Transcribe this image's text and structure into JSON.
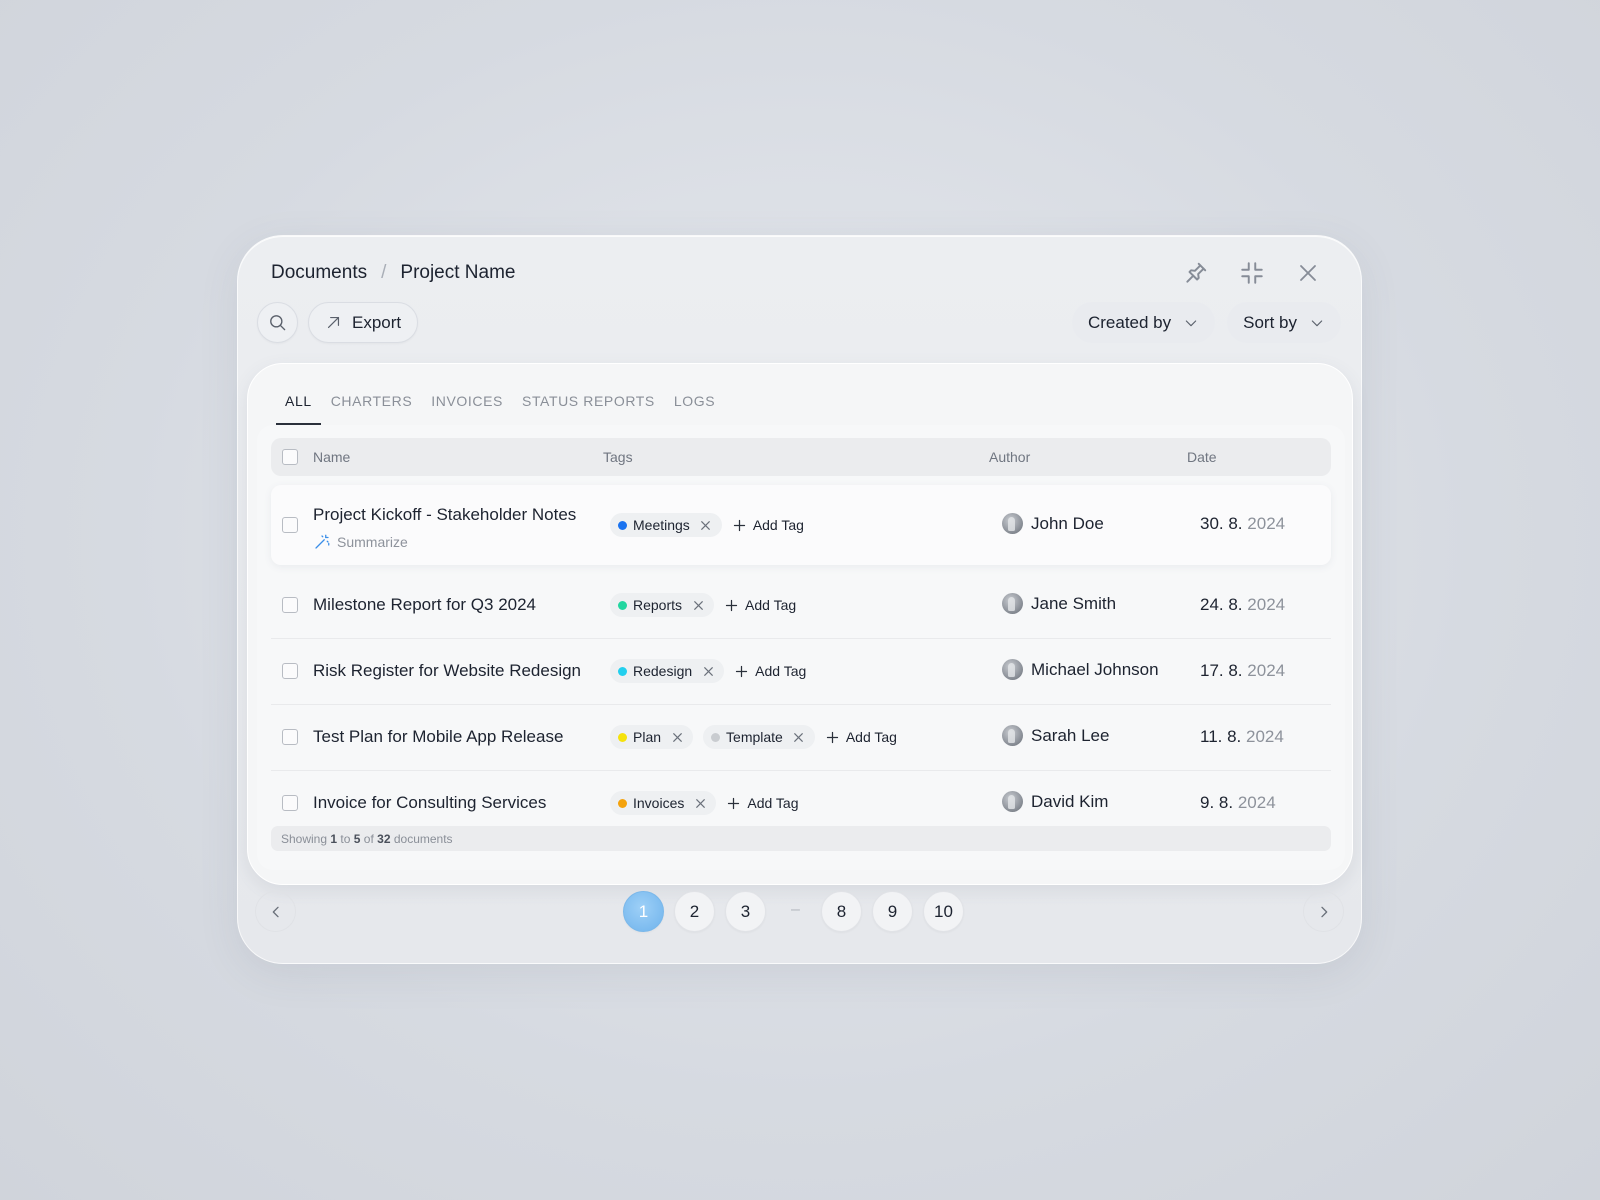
{
  "breadcrumb": {
    "root": "Documents",
    "separator": "/",
    "current": "Project Name"
  },
  "window_controls": {
    "pin": "pin-icon",
    "minimize": "collapse-icon",
    "close": "close-icon"
  },
  "toolbar": {
    "search_icon": "search-icon",
    "export_label": "Export",
    "created_by_label": "Created by",
    "sort_by_label": "Sort by"
  },
  "tabs": [
    {
      "label": "ALL",
      "active": true
    },
    {
      "label": "CHARTERS",
      "active": false
    },
    {
      "label": "INVOICES",
      "active": false
    },
    {
      "label": "STATUS REPORTS",
      "active": false
    },
    {
      "label": "LOGS",
      "active": false
    }
  ],
  "table": {
    "columns": {
      "name": "Name",
      "tags": "Tags",
      "author": "Author",
      "date": "Date"
    },
    "add_tag_label": "Add Tag",
    "summarize_label": "Summarize",
    "rows": [
      {
        "name": "Project Kickoff - Stakeholder Notes",
        "tags": [
          {
            "label": "Meetings",
            "color": "#1a73f0"
          }
        ],
        "author": "John Doe",
        "date_day": "30. 8.",
        "date_year": "2024"
      },
      {
        "name": "Milestone Report for Q3 2024",
        "tags": [
          {
            "label": "Reports",
            "color": "#22d6a0"
          }
        ],
        "author": "Jane Smith",
        "date_day": "24. 8.",
        "date_year": "2024"
      },
      {
        "name": "Risk Register for Website Redesign",
        "tags": [
          {
            "label": "Redesign",
            "color": "#22cfee"
          }
        ],
        "author": "Michael Johnson",
        "date_day": "17. 8.",
        "date_year": "2024"
      },
      {
        "name": "Test Plan for Mobile App Release",
        "tags": [
          {
            "label": "Plan",
            "color": "#f5e20c"
          },
          {
            "label": "Template",
            "color": "#c9ccd0"
          }
        ],
        "author": "Sarah Lee",
        "date_day": "11. 8.",
        "date_year": "2024"
      },
      {
        "name": "Invoice for Consulting Services",
        "tags": [
          {
            "label": "Invoices",
            "color": "#f4a20c"
          }
        ],
        "author": "David Kim",
        "date_day": "9. 8.",
        "date_year": "2024"
      }
    ]
  },
  "footer": {
    "prefix": "Showing",
    "from": "1",
    "to_word": "to",
    "to": "5",
    "of_word": "of",
    "total": "32",
    "suffix": "documents"
  },
  "pagination": {
    "pages_left": [
      "1",
      "2",
      "3"
    ],
    "ellipsis": "–",
    "pages_right": [
      "8",
      "9",
      "10"
    ],
    "current": "1"
  },
  "colors": {
    "accent": "#6fb3ec",
    "text": "#1d2330",
    "muted": "#8d929b"
  }
}
